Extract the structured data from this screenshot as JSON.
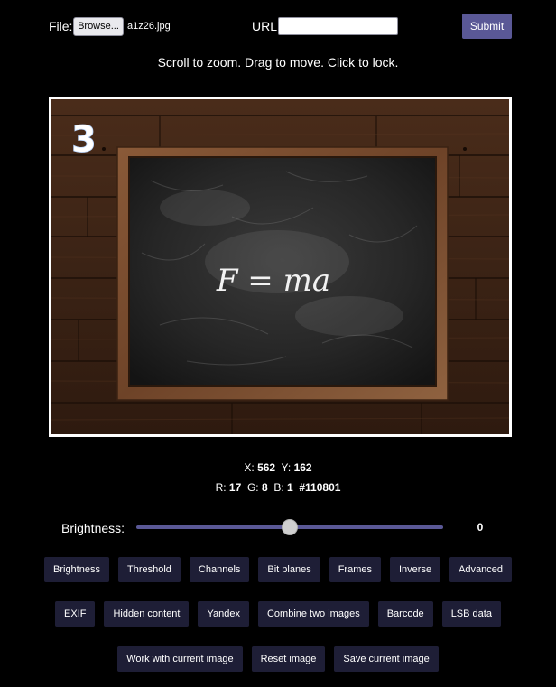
{
  "header": {
    "file_label": "File:",
    "browse_label": "Browse...",
    "file_name": "a1z26.jpg",
    "url_label": "URL:",
    "url_value": "",
    "submit_label": "Submit"
  },
  "instructions": "Scroll to zoom. Drag to move. Click to lock.",
  "image": {
    "corner_number": "3",
    "chalk_formula": "F = ma"
  },
  "readout": {
    "x_label": "X:",
    "x_value": "562",
    "y_label": "Y:",
    "y_value": "162",
    "r_label": "R:",
    "r_value": "17",
    "g_label": "G:",
    "g_value": "8",
    "b_label": "B:",
    "b_value": "1",
    "hex_value": "#110801"
  },
  "slider": {
    "label": "Brightness:",
    "value": "0",
    "min": -100,
    "max": 100
  },
  "buttons": {
    "row1": [
      "Brightness",
      "Threshold",
      "Channels",
      "Bit planes",
      "Frames",
      "Inverse",
      "Advanced"
    ],
    "row2": [
      "EXIF",
      "Hidden content",
      "Yandex",
      "Combine two images",
      "Barcode",
      "LSB data"
    ],
    "row3": [
      "Work with current image",
      "Reset image",
      "Save current image"
    ]
  },
  "colors": {
    "accent": "#5a5896",
    "button_bg": "#1e1e36",
    "background": "#000000"
  }
}
